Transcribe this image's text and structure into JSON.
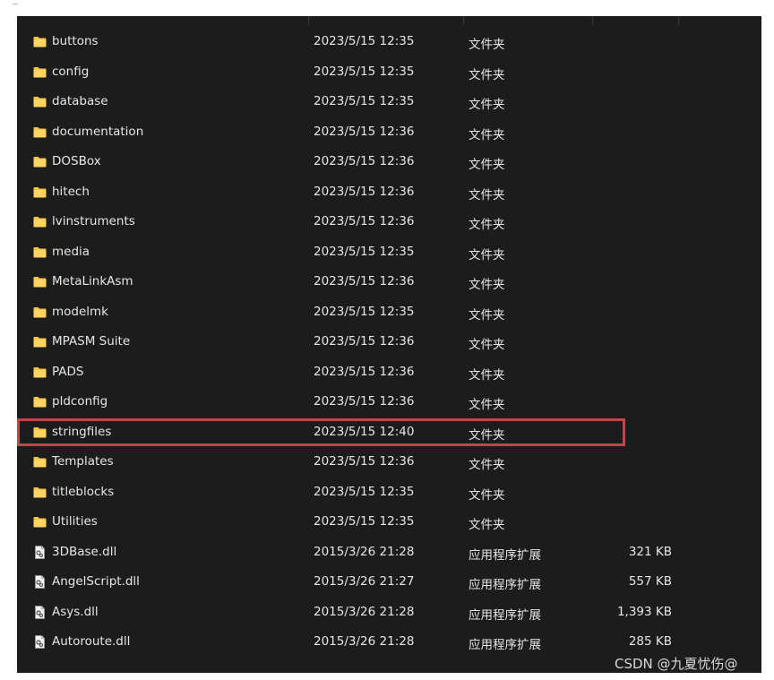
{
  "files": [
    {
      "name": "buttons",
      "date": "2023/5/15 12:35",
      "type": "文件夹",
      "size": "",
      "kind": "folder"
    },
    {
      "name": "config",
      "date": "2023/5/15 12:35",
      "type": "文件夹",
      "size": "",
      "kind": "folder"
    },
    {
      "name": "database",
      "date": "2023/5/15 12:35",
      "type": "文件夹",
      "size": "",
      "kind": "folder"
    },
    {
      "name": "documentation",
      "date": "2023/5/15 12:36",
      "type": "文件夹",
      "size": "",
      "kind": "folder"
    },
    {
      "name": "DOSBox",
      "date": "2023/5/15 12:36",
      "type": "文件夹",
      "size": "",
      "kind": "folder"
    },
    {
      "name": "hitech",
      "date": "2023/5/15 12:36",
      "type": "文件夹",
      "size": "",
      "kind": "folder"
    },
    {
      "name": "lvinstruments",
      "date": "2023/5/15 12:36",
      "type": "文件夹",
      "size": "",
      "kind": "folder"
    },
    {
      "name": "media",
      "date": "2023/5/15 12:35",
      "type": "文件夹",
      "size": "",
      "kind": "folder"
    },
    {
      "name": "MetaLinkAsm",
      "date": "2023/5/15 12:36",
      "type": "文件夹",
      "size": "",
      "kind": "folder"
    },
    {
      "name": "modelmk",
      "date": "2023/5/15 12:35",
      "type": "文件夹",
      "size": "",
      "kind": "folder"
    },
    {
      "name": "MPASM Suite",
      "date": "2023/5/15 12:36",
      "type": "文件夹",
      "size": "",
      "kind": "folder"
    },
    {
      "name": "PADS",
      "date": "2023/5/15 12:36",
      "type": "文件夹",
      "size": "",
      "kind": "folder"
    },
    {
      "name": "pldconfig",
      "date": "2023/5/15 12:36",
      "type": "文件夹",
      "size": "",
      "kind": "folder"
    },
    {
      "name": "stringfiles",
      "date": "2023/5/15 12:40",
      "type": "文件夹",
      "size": "",
      "kind": "folder",
      "highlighted": true
    },
    {
      "name": "Templates",
      "date": "2023/5/15 12:36",
      "type": "文件夹",
      "size": "",
      "kind": "folder"
    },
    {
      "name": "titleblocks",
      "date": "2023/5/15 12:35",
      "type": "文件夹",
      "size": "",
      "kind": "folder"
    },
    {
      "name": "Utilities",
      "date": "2023/5/15 12:35",
      "type": "文件夹",
      "size": "",
      "kind": "folder"
    },
    {
      "name": "3DBase.dll",
      "date": "2015/3/26 21:28",
      "type": "应用程序扩展",
      "size": "321 KB",
      "kind": "dll"
    },
    {
      "name": "AngelScript.dll",
      "date": "2015/3/26 21:27",
      "type": "应用程序扩展",
      "size": "557 KB",
      "kind": "dll"
    },
    {
      "name": "Asys.dll",
      "date": "2015/3/26 21:28",
      "type": "应用程序扩展",
      "size": "1,393 KB",
      "kind": "dll"
    },
    {
      "name": "Autoroute.dll",
      "date": "2015/3/26 21:28",
      "type": "应用程序扩展",
      "size": "285 KB",
      "kind": "dll"
    }
  ],
  "watermark": "CSDN @九夏忧伤@",
  "colors": {
    "background": "#1c1c1c",
    "text": "#e6e6e6",
    "folder": "#f3c64a",
    "highlight_border": "#c0464b"
  }
}
